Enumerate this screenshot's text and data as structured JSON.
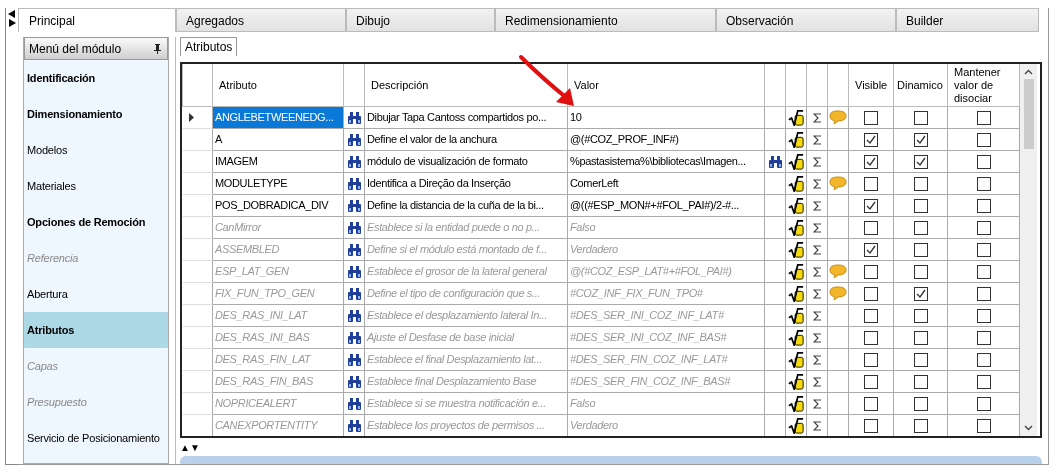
{
  "tabs": [
    {
      "label": "Principal",
      "selected": true
    },
    {
      "label": "Agregados",
      "selected": false
    },
    {
      "label": "Dibujo",
      "selected": false
    },
    {
      "label": "Redimensionamiento",
      "selected": false
    },
    {
      "label": "Observación",
      "selected": false
    },
    {
      "label": "Builder",
      "selected": false
    }
  ],
  "module_menu": {
    "title": "Menú del módulo",
    "items": [
      {
        "label": "Identificación",
        "bold": true,
        "disabled": false,
        "selected": false
      },
      {
        "label": "Dimensionamiento",
        "bold": true,
        "disabled": false,
        "selected": false
      },
      {
        "label": "Modelos",
        "bold": false,
        "disabled": false,
        "selected": false
      },
      {
        "label": "Materiales",
        "bold": false,
        "disabled": false,
        "selected": false
      },
      {
        "label": "Opciones de Remoción",
        "bold": true,
        "disabled": false,
        "selected": false
      },
      {
        "label": "Referencia",
        "bold": false,
        "disabled": true,
        "selected": false
      },
      {
        "label": "Abertura",
        "bold": false,
        "disabled": false,
        "selected": false
      },
      {
        "label": "Atributos",
        "bold": true,
        "disabled": false,
        "selected": true
      },
      {
        "label": "Capas",
        "bold": false,
        "disabled": true,
        "selected": false
      },
      {
        "label": "Presupuesto",
        "bold": false,
        "disabled": true,
        "selected": false
      },
      {
        "label": "Servicio de Posicionamiento",
        "bold": false,
        "disabled": false,
        "selected": false
      }
    ]
  },
  "subtab": {
    "label": "Atributos",
    "selected": true
  },
  "grid": {
    "columns": [
      "Atributo",
      "Descripción",
      "Valor",
      "Visible",
      "Dinamico",
      "Mantener valor de disociar"
    ],
    "rows": [
      {
        "attribute": "ANGLEBETWEENEDG...",
        "description": "Dibujar Tapa Cantoss compartidos po...",
        "value": "10",
        "selected": true,
        "inherited": false,
        "value_lookup": false,
        "note": true,
        "visible": false,
        "dynamic": false,
        "keep": false
      },
      {
        "attribute": "A",
        "description": "Define el valor de la anchura",
        "value": "@(#COZ_PROF_INF#)",
        "selected": false,
        "inherited": false,
        "value_lookup": false,
        "note": false,
        "visible": true,
        "dynamic": true,
        "keep": false
      },
      {
        "attribute": "IMAGEM",
        "description": "módulo de visualización de formato",
        "value": "%pastasistema%\\bibliotecas\\Imagen...",
        "selected": false,
        "inherited": false,
        "value_lookup": true,
        "note": false,
        "visible": true,
        "dynamic": true,
        "keep": false
      },
      {
        "attribute": "MODULETYPE",
        "description": "Identifica a Direção da Inserção",
        "value": "ComerLeft",
        "selected": false,
        "inherited": false,
        "value_lookup": false,
        "note": true,
        "visible": false,
        "dynamic": false,
        "keep": false
      },
      {
        "attribute": "POS_DOBRADICA_DIV",
        "description": "Define la distancia de la cuña de la bi...",
        "value": "@((#ESP_MON#+#FOL_PAI#)/2-#...",
        "selected": false,
        "inherited": false,
        "value_lookup": false,
        "note": false,
        "visible": true,
        "dynamic": false,
        "keep": false
      },
      {
        "attribute": "CanMirror",
        "description": "Establece si la entidad puede o no p...",
        "value": "Falso",
        "selected": false,
        "inherited": true,
        "value_lookup": false,
        "note": false,
        "visible": false,
        "dynamic": false,
        "keep": false
      },
      {
        "attribute": "ASSEMBLED",
        "description": "Define si el módulo está montado de f...",
        "value": "Verdadero",
        "selected": false,
        "inherited": true,
        "value_lookup": false,
        "note": false,
        "visible": true,
        "dynamic": false,
        "keep": false
      },
      {
        "attribute": "ESP_LAT_GEN",
        "description": "Establece el grosor de la lateral general",
        "value": "@(#COZ_ESP_LAT#+#FOL_PAI#)",
        "selected": false,
        "inherited": true,
        "value_lookup": false,
        "note": true,
        "visible": false,
        "dynamic": false,
        "keep": false
      },
      {
        "attribute": "FIX_FUN_TPO_GEN",
        "description": "Define el tipo de configuración que s...",
        "value": "#COZ_INF_FIX_FUN_TPO#",
        "selected": false,
        "inherited": true,
        "value_lookup": false,
        "note": true,
        "visible": false,
        "dynamic": true,
        "keep": false
      },
      {
        "attribute": "DES_RAS_INI_LAT",
        "description": "Establece el desplazamiento lateral In...",
        "value": "#DES_SER_INI_COZ_INF_LAT#",
        "selected": false,
        "inherited": true,
        "value_lookup": false,
        "note": false,
        "visible": false,
        "dynamic": false,
        "keep": false
      },
      {
        "attribute": "DES_RAS_INI_BAS",
        "description": "Ajuste el Desfase de base inicial",
        "value": "#DES_SER_INI_COZ_INF_BAS#",
        "selected": false,
        "inherited": true,
        "value_lookup": false,
        "note": false,
        "visible": false,
        "dynamic": false,
        "keep": false
      },
      {
        "attribute": "DES_RAS_FIN_LAT",
        "description": "Establece el final Desplazamiento lat...",
        "value": "#DES_SER_FIN_COZ_INF_LAT#",
        "selected": false,
        "inherited": true,
        "value_lookup": false,
        "note": false,
        "visible": false,
        "dynamic": false,
        "keep": false
      },
      {
        "attribute": "DES_RAS_FIN_BAS",
        "description": "Establece final Desplazamiento Base",
        "value": "#DES_SER_FIN_COZ_INF_BAS#",
        "selected": false,
        "inherited": true,
        "value_lookup": false,
        "note": false,
        "visible": false,
        "dynamic": false,
        "keep": false
      },
      {
        "attribute": "NOPRICEALERT",
        "description": "Establece si se muestra notificación e...",
        "value": "Falso",
        "selected": false,
        "inherited": true,
        "value_lookup": false,
        "note": false,
        "visible": false,
        "dynamic": false,
        "keep": false
      },
      {
        "attribute": "CANEXPORTENTITY",
        "description": "Establece los proyectos de permisos ...",
        "value": "Verdadero",
        "selected": false,
        "inherited": true,
        "value_lookup": false,
        "note": false,
        "visible": false,
        "dynamic": false,
        "keep": false
      }
    ]
  },
  "sort_arrows": "▲▼"
}
